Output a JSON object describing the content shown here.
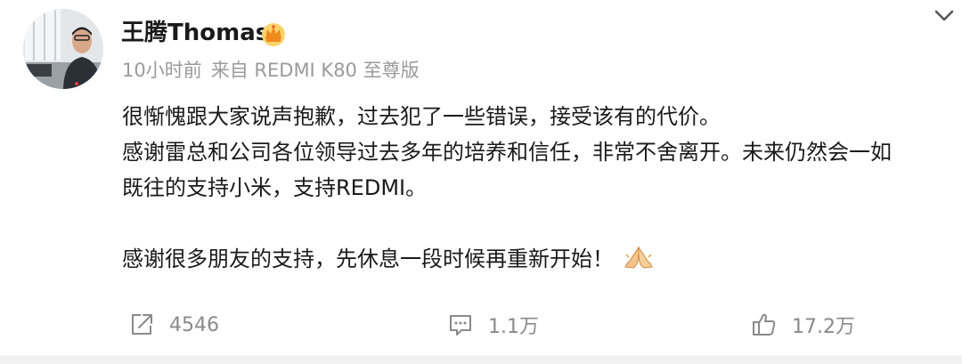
{
  "post": {
    "author": {
      "name": "王腾Thomas",
      "badge_icon": "crown-icon",
      "badge_color": "#f5a623"
    },
    "meta": {
      "time": "10小时前",
      "source": "来自 REDMI K80 至尊版"
    },
    "content": {
      "lines": [
        "很惭愧跟大家说声抱歉，过去犯了一些错误，接受该有的代价。",
        "感谢雷总和公司各位领导过去多年的培养和信任，非常不舍离开。未来仍然会一如",
        "既往的支持小米，支持REDMI。",
        "感谢很多朋友的支持，先休息一段时候再重新开始！"
      ],
      "emoji_icon": "praying-hands-icon"
    },
    "actions": {
      "repost_count": "4546",
      "comment_count": "1.1万",
      "like_count": "17.2万"
    },
    "menu_icon": "chevron-down-icon"
  }
}
